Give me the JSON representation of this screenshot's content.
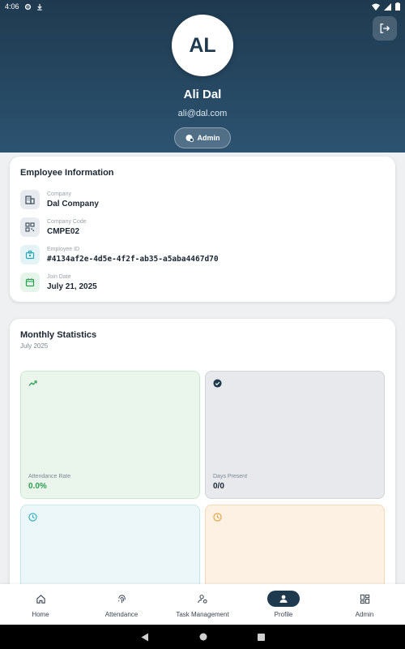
{
  "status_bar": {
    "time": "4:06"
  },
  "profile": {
    "initials": "AL",
    "name": "Ali Dal",
    "email": "ali@dal.com",
    "role": "Admin"
  },
  "employee_info": {
    "title": "Employee Information",
    "rows": [
      {
        "label": "Company",
        "value": "Dal Company",
        "icon": "building-icon"
      },
      {
        "label": "Company Code",
        "value": "CMPE02",
        "icon": "qr-code-icon"
      },
      {
        "label": "Employee ID",
        "value": "#4134af2e-4d5e-4f2f-ab35-a5aba4467d70",
        "icon": "id-badge-icon"
      },
      {
        "label": "Join Date",
        "value": "July 21, 2025",
        "icon": "calendar-icon"
      }
    ]
  },
  "monthly_stats": {
    "title": "Monthly Statistics",
    "subtitle": "July 2025",
    "tiles": [
      {
        "label": "Attendance Rate",
        "value": "0.0%",
        "icon": "trending-up-icon",
        "color": "#2e9e53"
      },
      {
        "label": "Days Present",
        "value": "0/0",
        "icon": "check-circle-icon",
        "color": "#1f3a4f"
      },
      {
        "label": "",
        "value": "",
        "icon": "clock-icon",
        "color": "#27a8b8"
      },
      {
        "label": "",
        "value": "",
        "icon": "clock-icon",
        "color": "#e0a23a"
      }
    ]
  },
  "bottom_nav": {
    "items": [
      {
        "label": "Home",
        "icon": "home-icon"
      },
      {
        "label": "Attendance",
        "icon": "fingerprint-icon"
      },
      {
        "label": "Task Management",
        "icon": "task-management-icon"
      },
      {
        "label": "Profile",
        "icon": "person-icon",
        "active": true
      },
      {
        "label": "Admin",
        "icon": "dashboard-grid-icon"
      }
    ]
  },
  "colors": {
    "header_dark": "#1f3a4f",
    "header_light": "#2c5371",
    "accent_green": "#2e9e53",
    "tile_green_bg": "#eaf6ec",
    "tile_gray_bg": "#e7e9ec",
    "tile_cyan_bg": "#ecf7f9",
    "tile_orange_bg": "#fdf1e3"
  }
}
